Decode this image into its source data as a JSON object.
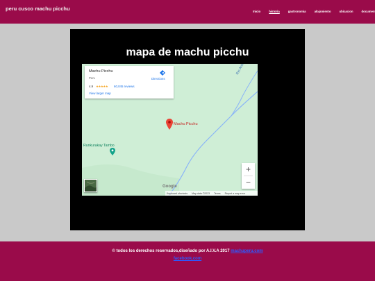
{
  "header": {
    "site_title": "peru cusco machu picchu",
    "nav": [
      {
        "label": "Inicio"
      },
      {
        "label": "historia"
      },
      {
        "label": "gastronomia"
      },
      {
        "label": "alojamiento"
      },
      {
        "label": "ubicacion"
      },
      {
        "label": "documental"
      }
    ],
    "active_index": 1
  },
  "main": {
    "heading": "mapa de machu picchu",
    "map": {
      "info_card": {
        "place_name": "Machu Picchu",
        "region": "Peru",
        "rating": "4.9",
        "stars": "★★★★★",
        "reviews": "60,045 reviews",
        "view_larger": "View larger map",
        "directions": "Directions"
      },
      "marker_label": "Machu Picchu",
      "tambo_label": "Runkurakay Tambo",
      "river_label": "Rio Aobamba",
      "zoom_in": "+",
      "zoom_out": "−",
      "google_logo": "Google",
      "attribution": {
        "shortcuts": "Keyboard shortcuts",
        "map_data": "Map data ©2023",
        "terms": "Terms",
        "report": "Report a map error"
      }
    }
  },
  "footer": {
    "rights_text": "© todos los derechos reservados,diseñado por A.I.V.A 2017",
    "rights_link": "machuperu.com",
    "social_link": "facebook.com"
  },
  "colors": {
    "header_bg": "#9a0b4a",
    "page_bg": "#c9c9c9",
    "content_bg": "#000000",
    "map_bg": "#cfeed6",
    "link": "#2b5bff"
  }
}
